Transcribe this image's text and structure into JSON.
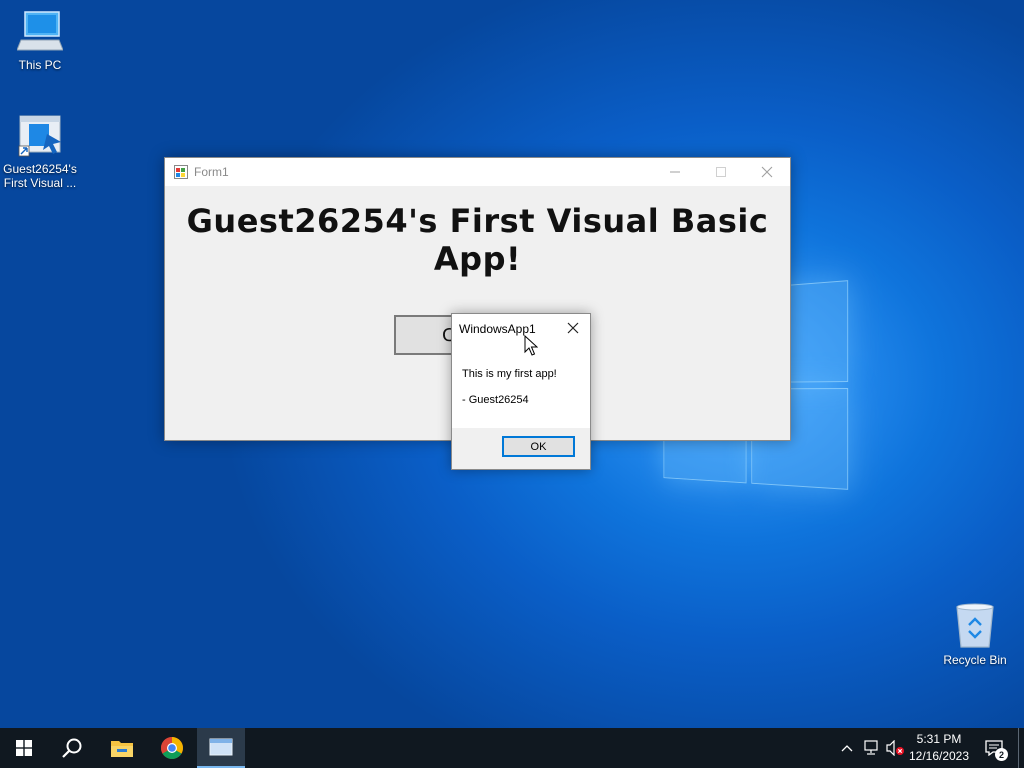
{
  "desktop": {
    "icons": [
      {
        "label": "This PC",
        "icon": "this-pc-icon"
      },
      {
        "label_line1": "Guest26254's",
        "label_line2": "First Visual ...",
        "icon": "app-shortcut-icon"
      },
      {
        "label": "Recycle Bin",
        "icon": "recycle-bin-icon"
      }
    ]
  },
  "form": {
    "title": "Form1",
    "heading": "Guest26254's First Visual Basic App!",
    "button_label": "C"
  },
  "messagebox": {
    "title": "WindowsApp1",
    "line1": "This is my first app!",
    "line2": "- Guest26254",
    "ok_label": "OK"
  },
  "taskbar": {
    "items": [
      "start-icon",
      "search-icon",
      "file-explorer-icon",
      "chrome-icon",
      "app-window-icon"
    ],
    "time": "5:31 PM",
    "date": "12/16/2023",
    "notification_count": "2"
  },
  "colors": {
    "accent": "#0078d7",
    "taskbar": "#101820"
  }
}
